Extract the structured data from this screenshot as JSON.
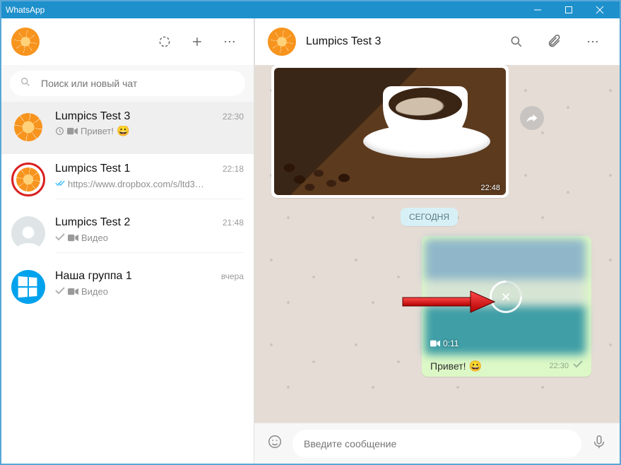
{
  "window": {
    "title": "WhatsApp"
  },
  "search": {
    "placeholder": "Поиск или новый чат"
  },
  "chats": [
    {
      "name": "Lumpics Test 3",
      "time": "22:30",
      "preview": "Привет!",
      "status": "pending",
      "has_video_icon": true,
      "selected": true,
      "avatar": "orange"
    },
    {
      "name": "Lumpics Test 1",
      "time": "22:18",
      "preview": "https://www.dropbox.com/s/ltd3…",
      "status": "read",
      "has_video_icon": false,
      "selected": false,
      "avatar": "orange-red"
    },
    {
      "name": "Lumpics Test 2",
      "time": "21:48",
      "preview": "Видео",
      "status": "sent",
      "has_video_icon": true,
      "selected": false,
      "avatar": "grey"
    },
    {
      "name": "Наша группа 1",
      "time": "вчера",
      "preview": "Видео",
      "status": "sent",
      "has_video_icon": true,
      "selected": false,
      "avatar": "windows"
    }
  ],
  "conversation": {
    "contact_name": "Lumpics Test 3",
    "incoming_image_time": "22:48",
    "date_label": "СЕГОДНЯ",
    "outgoing": {
      "video_duration": "0:11",
      "caption": "Привет!",
      "time": "22:30"
    }
  },
  "composer": {
    "placeholder": "Введите сообщение"
  }
}
